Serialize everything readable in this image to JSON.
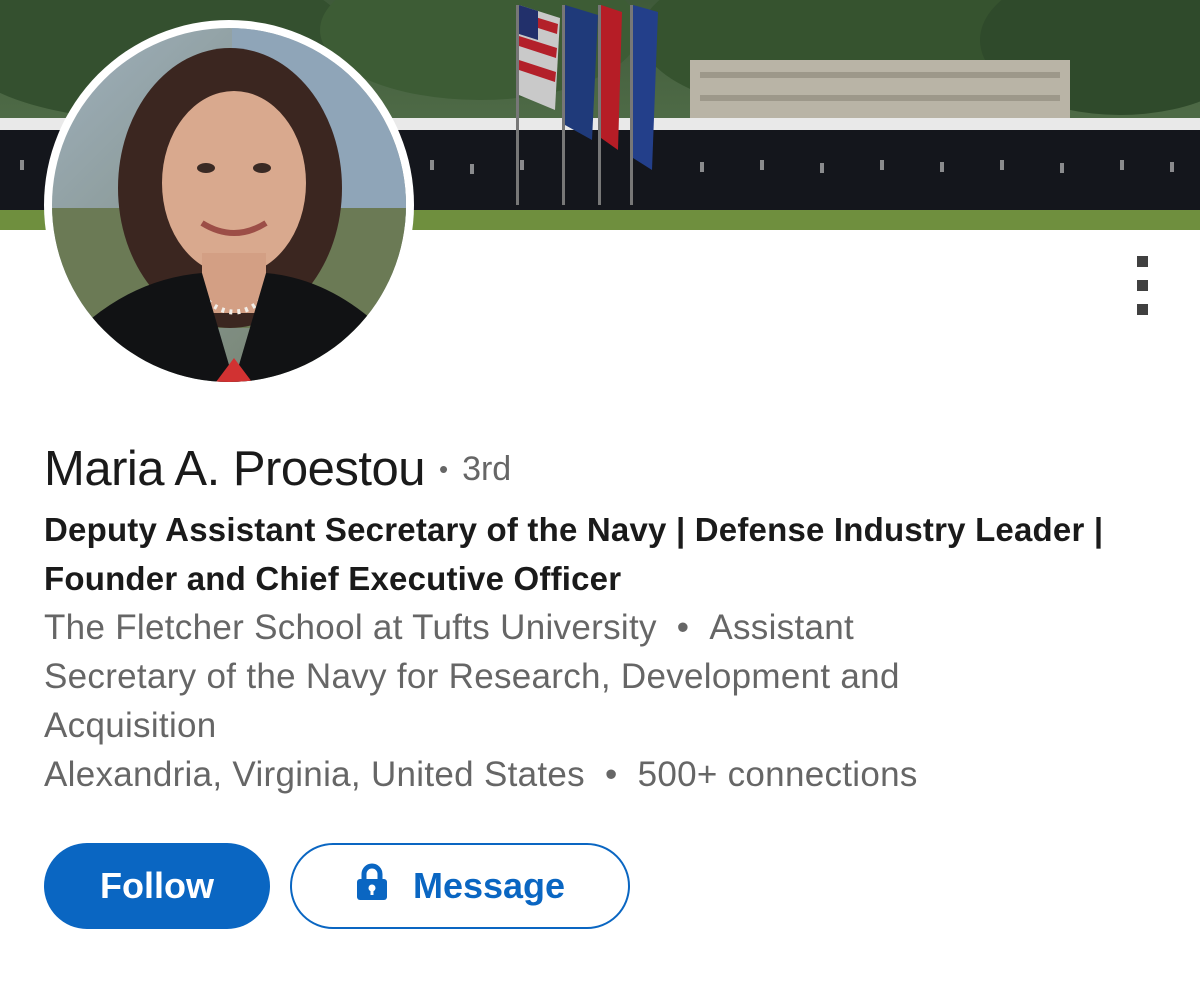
{
  "profile": {
    "name": "Maria A. Proestou",
    "degree_separator": "•",
    "degree": "3rd",
    "headline": "Deputy Assistant Secretary of the Navy | Defense Industry Leader | Founder and Chief Executive Officer",
    "education_line_1_school": "The Fletcher School at Tufts University",
    "education_separator": "•",
    "education_line_1_role": "Assistant",
    "education_line_2": "Secretary of the Navy for Research, Development and",
    "education_line_3": "Acquisition",
    "location": "Alexandria, Virginia, United States",
    "location_separator": "•",
    "connections": "500+ connections"
  },
  "actions": {
    "follow_label": "Follow",
    "message_label": "Message",
    "message_icon": "lock-icon",
    "more_icon": "more-vertical-icon"
  },
  "colors": {
    "accent": "#0a66c2",
    "primary_text": "#1a1a1a",
    "secondary_text": "#666666"
  }
}
